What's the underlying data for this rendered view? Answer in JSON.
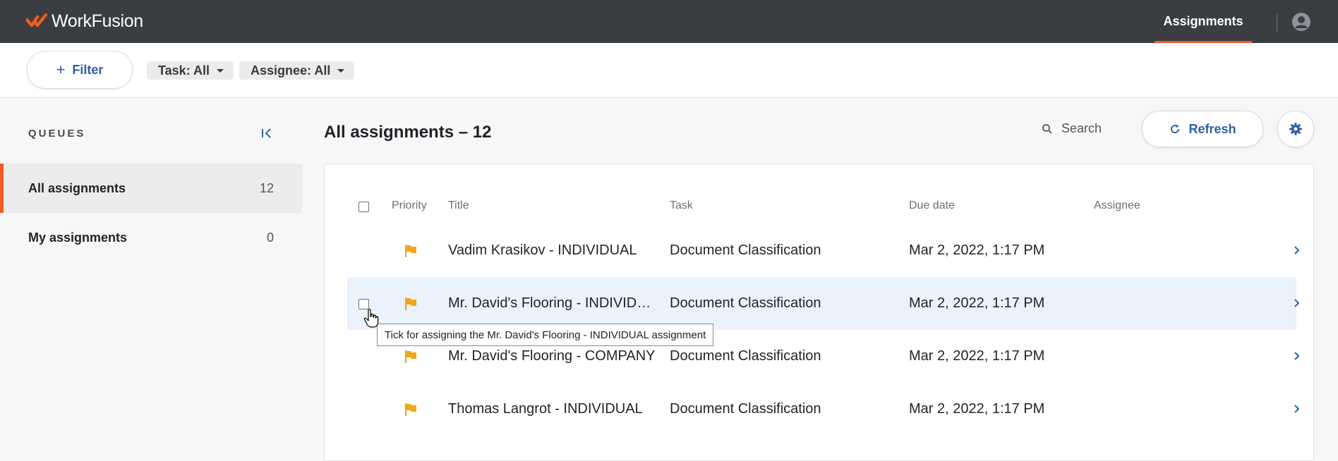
{
  "brand": {
    "name": "WorkFusion"
  },
  "topnav": {
    "active_tab": "Assignments"
  },
  "filterbar": {
    "filter_label": "Filter",
    "chips": [
      {
        "label": "Task: All"
      },
      {
        "label": "Assignee: All"
      }
    ]
  },
  "sidebar": {
    "title": "QUEUES",
    "items": [
      {
        "label": "All assignments",
        "count": "12"
      },
      {
        "label": "My assignments",
        "count": "0"
      }
    ]
  },
  "main": {
    "title": "All assignments – 12",
    "search_label": "Search",
    "refresh_label": "Refresh"
  },
  "table": {
    "columns": [
      "Priority",
      "Title",
      "Task",
      "Due date",
      "Assignee"
    ],
    "rows": [
      {
        "title": "Vadim Krasikov - INDIVIDUAL",
        "task": "Document Classification",
        "due": "Mar 2, 2022, 1:17 PM",
        "assignee": ""
      },
      {
        "title": "Mr. David's Flooring - INDIVID…",
        "task": "Document Classification",
        "due": "Mar 2, 2022, 1:17 PM",
        "assignee": ""
      },
      {
        "title": "Mr. David's Flooring - COMPANY",
        "task": "Document Classification",
        "due": "Mar 2, 2022, 1:17 PM",
        "assignee": ""
      },
      {
        "title": "Thomas Langrot - INDIVIDUAL",
        "task": "Document Classification",
        "due": "Mar 2, 2022, 1:17 PM",
        "assignee": ""
      }
    ]
  },
  "tooltip": {
    "text": "Tick for assigning the Mr. David's Flooring - INDIVIDUAL assignment"
  },
  "colors": {
    "accent": "#f15a24",
    "topbar": "#3a3d42",
    "link": "#2f5fa6",
    "flag": "#f2a51d",
    "row_hover": "#eaf2fb"
  }
}
